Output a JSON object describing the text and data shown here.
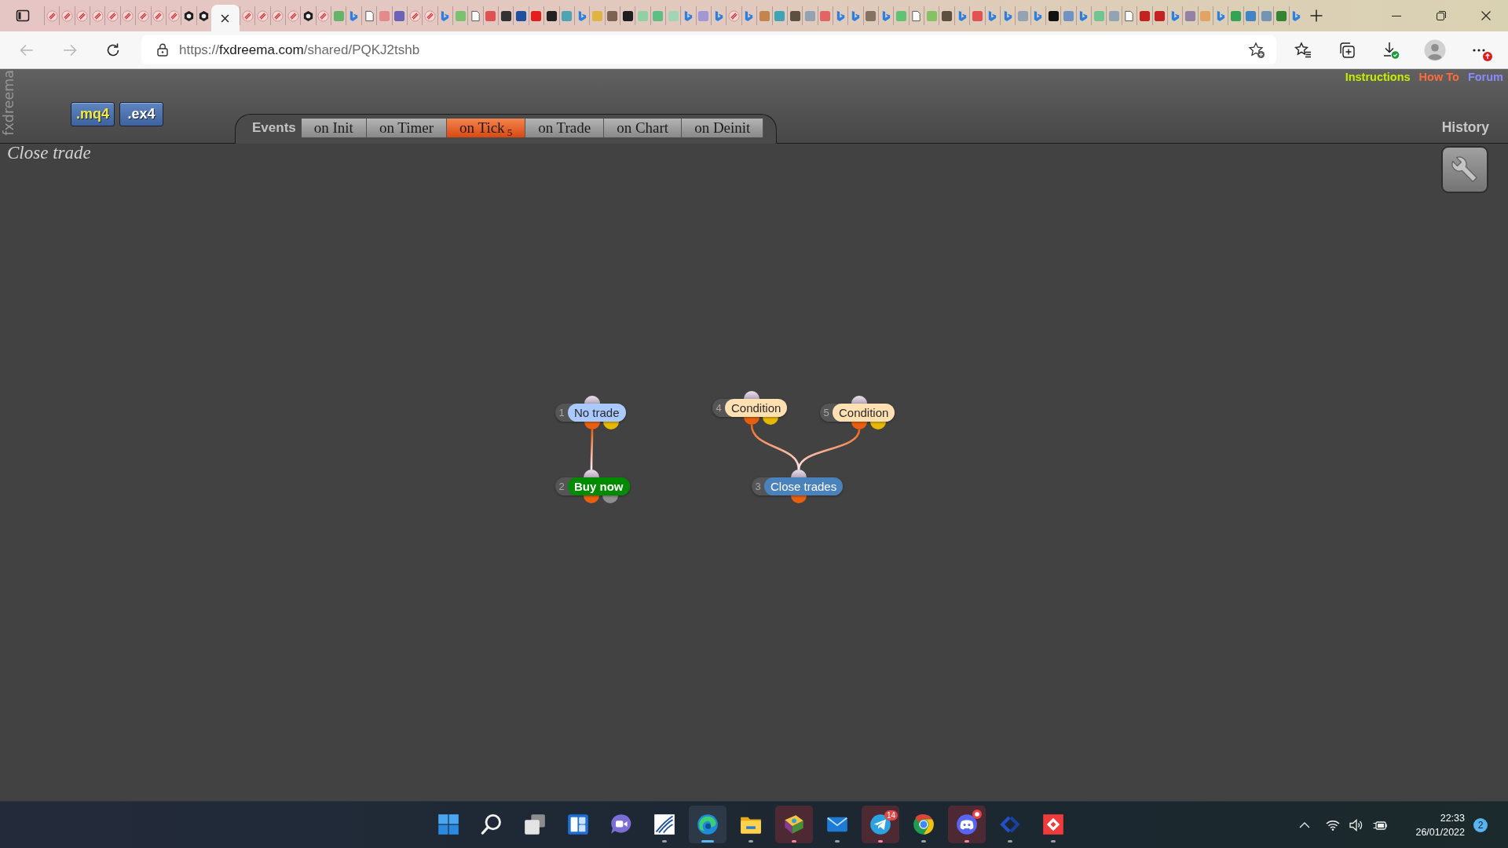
{
  "browser": {
    "tabs": [
      {
        "kind": "stripe",
        "selected": false
      },
      {
        "kind": "stripe",
        "selected": false
      },
      {
        "kind": "stripe",
        "selected": false
      },
      {
        "kind": "stripe",
        "selected": false
      },
      {
        "kind": "stripe",
        "selected": false
      },
      {
        "kind": "stripe",
        "selected": false
      },
      {
        "kind": "stripe",
        "selected": false
      },
      {
        "kind": "stripe",
        "selected": false
      },
      {
        "kind": "stripe",
        "selected": false
      },
      {
        "kind": "hex",
        "selected": false
      },
      {
        "kind": "hex",
        "selected": false
      },
      {
        "selected": true
      },
      {
        "kind": "stripe",
        "selected": false
      },
      {
        "kind": "stripe",
        "selected": false
      },
      {
        "kind": "stripe",
        "selected": false
      },
      {
        "kind": "stripe",
        "selected": false
      },
      {
        "kind": "hex",
        "selected": false
      },
      {
        "kind": "stripe",
        "selected": false
      },
      {
        "kind": "tile",
        "color": "#66b36a",
        "selected": false
      },
      {
        "kind": "swoosh",
        "selected": false
      },
      {
        "kind": "page",
        "selected": false
      },
      {
        "kind": "tile",
        "color": "#e38a8a",
        "selected": false
      },
      {
        "kind": "tile",
        "color": "#6a63b8",
        "selected": false
      },
      {
        "kind": "stripe",
        "selected": false
      },
      {
        "kind": "stripe",
        "selected": false
      },
      {
        "kind": "swoosh",
        "selected": false
      },
      {
        "kind": "tile",
        "color": "#7cc26e",
        "selected": false
      },
      {
        "kind": "page",
        "selected": false
      },
      {
        "kind": "tile",
        "color": "#e05252",
        "selected": false
      },
      {
        "kind": "tile",
        "color": "#333333",
        "selected": false
      },
      {
        "kind": "tile",
        "color": "#1f4f9e",
        "selected": false
      },
      {
        "kind": "tile",
        "color": "#e41e1e",
        "selected": false
      },
      {
        "kind": "tile",
        "color": "#222222",
        "selected": false
      },
      {
        "kind": "tile",
        "color": "#4fa3b3",
        "selected": false
      },
      {
        "kind": "swoosh",
        "selected": false
      },
      {
        "kind": "tile",
        "color": "#e0b442",
        "selected": false
      },
      {
        "kind": "tile",
        "color": "#7e6352",
        "selected": false
      },
      {
        "kind": "tile",
        "color": "#1e1e1e",
        "selected": false
      },
      {
        "kind": "tile",
        "color": "#8fd1a4",
        "selected": false
      },
      {
        "kind": "tile",
        "color": "#5fbf82",
        "selected": false
      },
      {
        "kind": "tile",
        "color": "#a4d4b6",
        "selected": false
      },
      {
        "kind": "swoosh",
        "selected": false
      },
      {
        "kind": "tile",
        "color": "#a396d4",
        "selected": false
      },
      {
        "kind": "swoosh",
        "selected": false
      },
      {
        "kind": "stripe",
        "selected": false
      },
      {
        "kind": "swoosh",
        "selected": false
      },
      {
        "kind": "tile",
        "color": "#c4844e",
        "selected": false
      },
      {
        "kind": "tile",
        "color": "#3fa4b4",
        "selected": false
      },
      {
        "kind": "tile",
        "color": "#5e5040",
        "selected": false
      },
      {
        "kind": "tile",
        "color": "#93a3b4",
        "selected": false
      },
      {
        "kind": "tile",
        "color": "#e26464",
        "selected": false
      },
      {
        "kind": "swoosh",
        "selected": false
      },
      {
        "kind": "swoosh",
        "selected": false
      },
      {
        "kind": "tile",
        "color": "#847262",
        "selected": false
      },
      {
        "kind": "swoosh",
        "selected": false
      },
      {
        "kind": "tile",
        "color": "#62c274",
        "selected": false
      },
      {
        "kind": "page",
        "selected": false
      },
      {
        "kind": "tile",
        "color": "#84c264",
        "selected": false
      },
      {
        "kind": "tile",
        "color": "#5e5040",
        "selected": false
      },
      {
        "kind": "swoosh",
        "selected": false
      },
      {
        "kind": "tile",
        "color": "#e25252",
        "selected": false
      },
      {
        "kind": "swoosh",
        "selected": false
      },
      {
        "kind": "swoosh",
        "selected": false
      },
      {
        "kind": "tile",
        "color": "#93a3b4",
        "selected": false
      },
      {
        "kind": "swoosh",
        "selected": false
      },
      {
        "kind": "tile",
        "color": "#111111",
        "selected": false
      },
      {
        "kind": "tile",
        "color": "#7392c4",
        "selected": false
      },
      {
        "kind": "swoosh",
        "selected": false
      },
      {
        "kind": "tile",
        "color": "#72c494",
        "selected": false
      },
      {
        "kind": "tile",
        "color": "#93a3b4",
        "selected": false
      },
      {
        "kind": "page",
        "selected": false
      },
      {
        "kind": "tile",
        "color": "#c42222",
        "selected": false
      },
      {
        "kind": "tile",
        "color": "#c42222",
        "selected": false
      },
      {
        "kind": "swoosh",
        "selected": false
      },
      {
        "kind": "tile",
        "color": "#9482a4",
        "selected": false
      },
      {
        "kind": "tile",
        "color": "#e2a464",
        "selected": false
      },
      {
        "kind": "swoosh",
        "selected": false
      },
      {
        "kind": "tile",
        "color": "#34a454",
        "selected": false
      },
      {
        "kind": "tile",
        "color": "#4284c4",
        "selected": false
      },
      {
        "kind": "tile",
        "color": "#7494b4",
        "selected": false
      },
      {
        "kind": "tile",
        "color": "#348434",
        "selected": false
      },
      {
        "kind": "swoosh",
        "selected": false
      }
    ],
    "url": {
      "scheme": "https://",
      "host": "fxdreema.com",
      "path": "/shared/PQKJ2tshb"
    },
    "back": {
      "disabled": true
    },
    "forward": {
      "disabled": true
    }
  },
  "header": {
    "brand": "fxdreema",
    "file_buttons": [
      {
        "label": ".mq4",
        "kind": "source"
      },
      {
        "label": ".ex4",
        "kind": "compiled"
      }
    ],
    "events_label": "Events",
    "event_tabs": [
      {
        "label": "on Init",
        "selected": false
      },
      {
        "label": "on Timer",
        "selected": false
      },
      {
        "label": "on Tick",
        "count": "5",
        "selected": true
      },
      {
        "label": "on Trade",
        "selected": false
      },
      {
        "label": "on Chart",
        "selected": false
      },
      {
        "label": "on Deinit",
        "selected": false
      }
    ],
    "links": [
      {
        "label": "Instructions",
        "color": "#c6ef00"
      },
      {
        "label": "How To",
        "color": "#ff6a3a"
      },
      {
        "label": "Forum",
        "color": "#8a8aff"
      }
    ],
    "history": "History"
  },
  "canvas": {
    "title": "Close trade",
    "nodes": [
      {
        "number": "1",
        "label": "No trade",
        "kind": "check",
        "outputs": [
          {
            "kind": "main",
            "linked": true
          },
          {
            "kind": "alt",
            "linked": false
          }
        ]
      },
      {
        "number": "4",
        "label": "Condition",
        "kind": "condition",
        "outputs": [
          {
            "kind": "main",
            "linked": true
          },
          {
            "kind": "alt",
            "linked": false
          }
        ]
      },
      {
        "number": "5",
        "label": "Condition",
        "kind": "condition",
        "outputs": [
          {
            "kind": "main",
            "linked": true
          },
          {
            "kind": "alt",
            "linked": false
          }
        ]
      },
      {
        "number": "2",
        "label": "Buy now",
        "kind": "buy",
        "outputs": [
          {
            "kind": "main",
            "linked": false
          },
          {
            "kind": "idle",
            "linked": false
          }
        ]
      },
      {
        "number": "3",
        "label": "Close trades",
        "kind": "close",
        "outputs": [
          {
            "kind": "main",
            "linked": false
          }
        ]
      }
    ]
  },
  "taskbar": {
    "items": [
      {
        "kind": "grid",
        "running": false,
        "attention": false,
        "focused": false,
        "alert": false
      },
      {
        "kind": "search",
        "running": false,
        "attention": false,
        "focused": false,
        "alert": false
      },
      {
        "kind": "windows",
        "running": false,
        "attention": false,
        "focused": false,
        "alert": false
      },
      {
        "kind": "widgets",
        "running": false,
        "attention": false,
        "focused": false,
        "alert": false
      },
      {
        "kind": "videochat",
        "running": false,
        "attention": false,
        "focused": false,
        "alert": false
      },
      {
        "kind": "swoosh",
        "running": true,
        "attention": false,
        "focused": false,
        "alert": false
      },
      {
        "kind": "swirl",
        "running": true,
        "attention": false,
        "focused": true,
        "alert": false
      },
      {
        "kind": "folder",
        "running": true,
        "attention": false,
        "focused": false,
        "alert": false
      },
      {
        "kind": "book",
        "running": true,
        "attention": true,
        "focused": false,
        "alert": false
      },
      {
        "kind": "envelope",
        "running": true,
        "attention": false,
        "focused": false,
        "alert": false
      },
      {
        "kind": "plane",
        "running": true,
        "attention": true,
        "focused": false,
        "alert": false,
        "badge": "14"
      },
      {
        "kind": "tricolor",
        "running": true,
        "attention": false,
        "focused": false,
        "alert": false
      },
      {
        "kind": "controller",
        "running": true,
        "attention": true,
        "focused": false,
        "alert": true
      },
      {
        "kind": "chevron",
        "running": true,
        "attention": false,
        "focused": false,
        "alert": false
      },
      {
        "kind": "diamond",
        "running": true,
        "attention": false,
        "focused": false,
        "alert": false
      }
    ],
    "tray": {
      "time": "22:33",
      "date": "26/01/2022",
      "notifications": "2"
    }
  }
}
